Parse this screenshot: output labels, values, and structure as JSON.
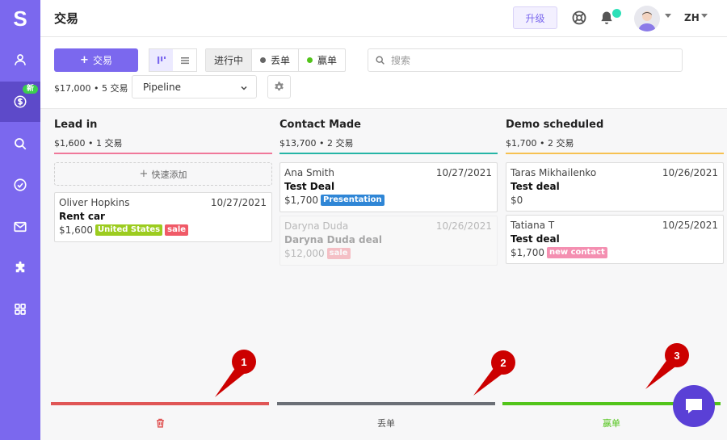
{
  "app": {
    "logo": "S"
  },
  "sidebar": {
    "items": [
      {
        "icon": "user-icon"
      },
      {
        "icon": "dollar-icon",
        "badge": "新",
        "active": true
      },
      {
        "icon": "search-icon"
      },
      {
        "icon": "check-circle-icon"
      },
      {
        "icon": "mail-icon"
      },
      {
        "icon": "puzzle-icon"
      },
      {
        "icon": "apps-grid-icon"
      }
    ]
  },
  "header": {
    "title": "交易",
    "upgrade_label": "升级",
    "lang": "ZH"
  },
  "toolbar": {
    "add_deal_label": "交易",
    "filters": [
      {
        "label": "进行中",
        "selected": true
      },
      {
        "label": "丢单",
        "dot_color": "#666666"
      },
      {
        "label": "赢单",
        "dot_color": "#52c41a"
      }
    ],
    "search_placeholder": "搜索",
    "summary": "$17,000 • 5 交易",
    "pipeline_value": "Pipeline"
  },
  "columns": [
    {
      "title": "Lead in",
      "summary": "$1,600 • 1 交易",
      "color": "#f0789a",
      "quick_add": "快速添加",
      "cards": [
        {
          "contact": "Oliver Hopkins",
          "date": "10/27/2021",
          "title": "Rent car",
          "amount": "$1,600",
          "tags": [
            {
              "label": "United States",
              "color": "#9ccc1f"
            },
            {
              "label": "sale",
              "color": "#f05a67"
            }
          ]
        }
      ]
    },
    {
      "title": "Contact Made",
      "summary": "$13,700 • 2 交易",
      "color": "#26b5a6",
      "cards": [
        {
          "contact": "Ana Smith",
          "date": "10/27/2021",
          "title": "Test Deal",
          "amount": "$1,700",
          "tags": [
            {
              "label": "Presentation",
              "color": "#2f86d6"
            }
          ]
        },
        {
          "contact": "Daryna Duda",
          "date": "10/26/2021",
          "title": "Daryna Duda deal",
          "amount": "$12,000",
          "faded": true,
          "tags": [
            {
              "label": "sale",
              "color": "#f05a67"
            }
          ]
        }
      ]
    },
    {
      "title": "Demo scheduled",
      "summary": "$1,700 • 2 交易",
      "color": "#f6c151",
      "cards": [
        {
          "contact": "Taras Mikhailenko",
          "date": "10/26/2021",
          "title": "Test deal",
          "amount": "$0",
          "tags": []
        },
        {
          "contact": "Tatiana T",
          "date": "10/25/2021",
          "title": "Test deal",
          "amount": "$1,700",
          "tags": [
            {
              "label": "new contact",
              "color": "#f48fb1"
            }
          ]
        }
      ]
    }
  ],
  "drop_zones": [
    {
      "icon": "trash-icon",
      "color": "#e05656"
    },
    {
      "label": "丢单",
      "color": "#6b6f76"
    },
    {
      "label": "赢单",
      "color": "#52c41a"
    }
  ],
  "markers": [
    "1",
    "2",
    "3"
  ],
  "colors": {
    "sidebar": "#7b68ee",
    "sidebar_active": "#5d4ac9",
    "marker": "#cc0000",
    "chat": "#5a40d6"
  }
}
